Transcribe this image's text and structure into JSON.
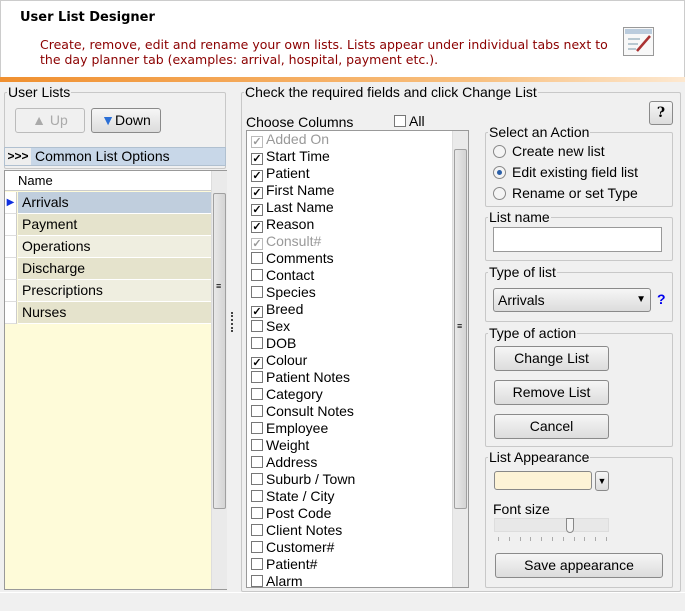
{
  "header": {
    "title": "User List Designer",
    "description": "Create, remove, edit and rename your own lists. Lists appear under individual tabs next to the day planner tab (examples: arrival, hospital, payment etc.).",
    "icon": "edit-list-icon"
  },
  "left": {
    "group_label": "User Lists",
    "up_label": "Up",
    "down_label": "Down",
    "common_marker": ">>>",
    "common_label": "Common List Options",
    "column_header": "Name",
    "selected_index": 0,
    "rows": [
      "Arrivals",
      "Payment",
      "Operations",
      "Discharge",
      "Prescriptions",
      "Nurses"
    ]
  },
  "right": {
    "group_label": "Check the required fields and click Change List",
    "help_label": "?",
    "choose_columns_label": "Choose Columns",
    "all_label": "All",
    "all_checked": false,
    "columns": [
      {
        "label": "Added On",
        "checked": true,
        "disabled": true
      },
      {
        "label": "Start Time",
        "checked": true
      },
      {
        "label": "Patient",
        "checked": true
      },
      {
        "label": "First Name",
        "checked": true
      },
      {
        "label": "Last Name",
        "checked": true
      },
      {
        "label": "Reason",
        "checked": true
      },
      {
        "label": "Consult#",
        "checked": true,
        "disabled": true
      },
      {
        "label": "Comments",
        "checked": false
      },
      {
        "label": "Contact",
        "checked": false
      },
      {
        "label": "Species",
        "checked": false
      },
      {
        "label": "Breed",
        "checked": true
      },
      {
        "label": "Sex",
        "checked": false
      },
      {
        "label": "DOB",
        "checked": false
      },
      {
        "label": "Colour",
        "checked": true
      },
      {
        "label": "Patient Notes",
        "checked": false
      },
      {
        "label": "Category",
        "checked": false
      },
      {
        "label": "Consult Notes",
        "checked": false
      },
      {
        "label": "Employee",
        "checked": false
      },
      {
        "label": "Weight",
        "checked": false
      },
      {
        "label": "Address",
        "checked": false
      },
      {
        "label": "Suburb / Town",
        "checked": false
      },
      {
        "label": "State / City",
        "checked": false
      },
      {
        "label": "Post Code",
        "checked": false
      },
      {
        "label": "Client Notes",
        "checked": false
      },
      {
        "label": "Customer#",
        "checked": false
      },
      {
        "label": "Patient#",
        "checked": false
      },
      {
        "label": "Alarm",
        "checked": false
      }
    ],
    "action": {
      "label": "Select an Action",
      "options": [
        "Create new list",
        "Edit existing field list",
        "Rename or set Type"
      ],
      "selected": 1
    },
    "list_name": {
      "label": "List name",
      "value": ""
    },
    "type_of_list": {
      "label": "Type of list",
      "value": "Arrivals",
      "help": "?"
    },
    "type_of_action": {
      "label": "Type of action",
      "change": "Change List",
      "remove": "Remove List",
      "cancel": "Cancel"
    },
    "appearance": {
      "label": "List Appearance",
      "color": "#fdf3d6",
      "font_size_label": "Font size",
      "font_size_level": 0.7,
      "save": "Save appearance"
    }
  }
}
